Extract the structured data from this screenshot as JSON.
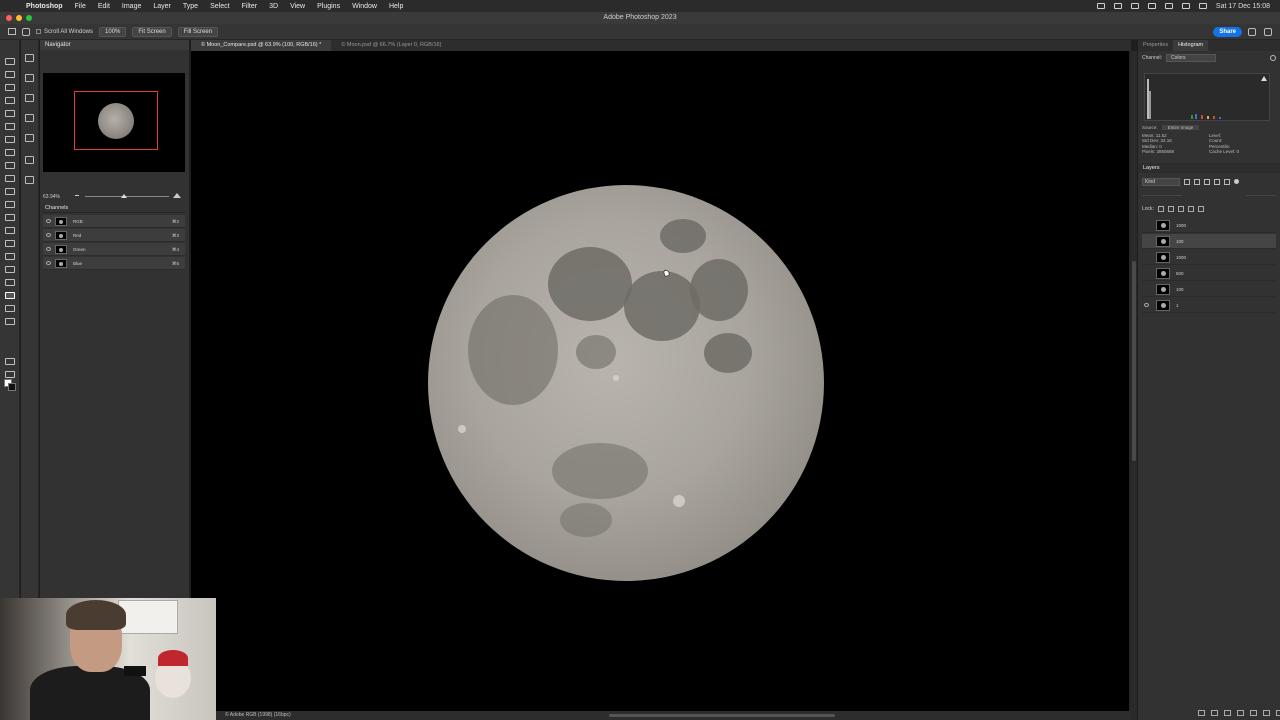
{
  "menubar": {
    "items": [
      "Photoshop",
      "File",
      "Edit",
      "Image",
      "Layer",
      "Type",
      "Select",
      "Filter",
      "3D",
      "View",
      "Plugins",
      "Window",
      "Help"
    ],
    "clock": "Sat 17 Dec 15:08"
  },
  "window": {
    "title": "Adobe Photoshop 2023"
  },
  "options": {
    "scroll_all": "Scroll All Windows",
    "zoom_100": "100%",
    "fit_screen": "Fit Screen",
    "fill_screen": "Fill Screen",
    "share": "Share"
  },
  "navigator": {
    "title": "Navigator",
    "zoom": "63.94%"
  },
  "channels": {
    "title": "Channels",
    "rows": [
      {
        "name": "RGB",
        "shortcut": "⌘2"
      },
      {
        "name": "Red",
        "shortcut": "⌘3"
      },
      {
        "name": "Green",
        "shortcut": "⌘4"
      },
      {
        "name": "Blue",
        "shortcut": "⌘5"
      }
    ]
  },
  "tabs": [
    "© Moon_Compare.psd @ 63.9% (100, RGB/16) *",
    "© Moon.psd @ 66.7% (Layer 0, RGB/16)"
  ],
  "statusbar": "© Adobe RGB (1998) (16bpc)",
  "right_panel": {
    "tabs": [
      "Properties",
      "Histogram"
    ],
    "channel_label": "Channel:",
    "channel_value": "Colors",
    "source_label": "Source:",
    "source_value": "Entire Image",
    "stats_left": [
      "Mean: 11.52",
      "Std Dev: 32.16",
      "Median: 0",
      "Pixels: 3850688"
    ],
    "stats_right": [
      "Level:",
      "Count:",
      "Percentile:",
      "Cache Level: 0"
    ],
    "layers_title": "Layers",
    "kind": "Kind",
    "lock": "Lock:",
    "layers": [
      "1000",
      "100",
      "1000",
      "500",
      "100",
      "1"
    ]
  },
  "colors": {
    "accent": "#1473e6",
    "nav_rect": "#e53b3b"
  }
}
